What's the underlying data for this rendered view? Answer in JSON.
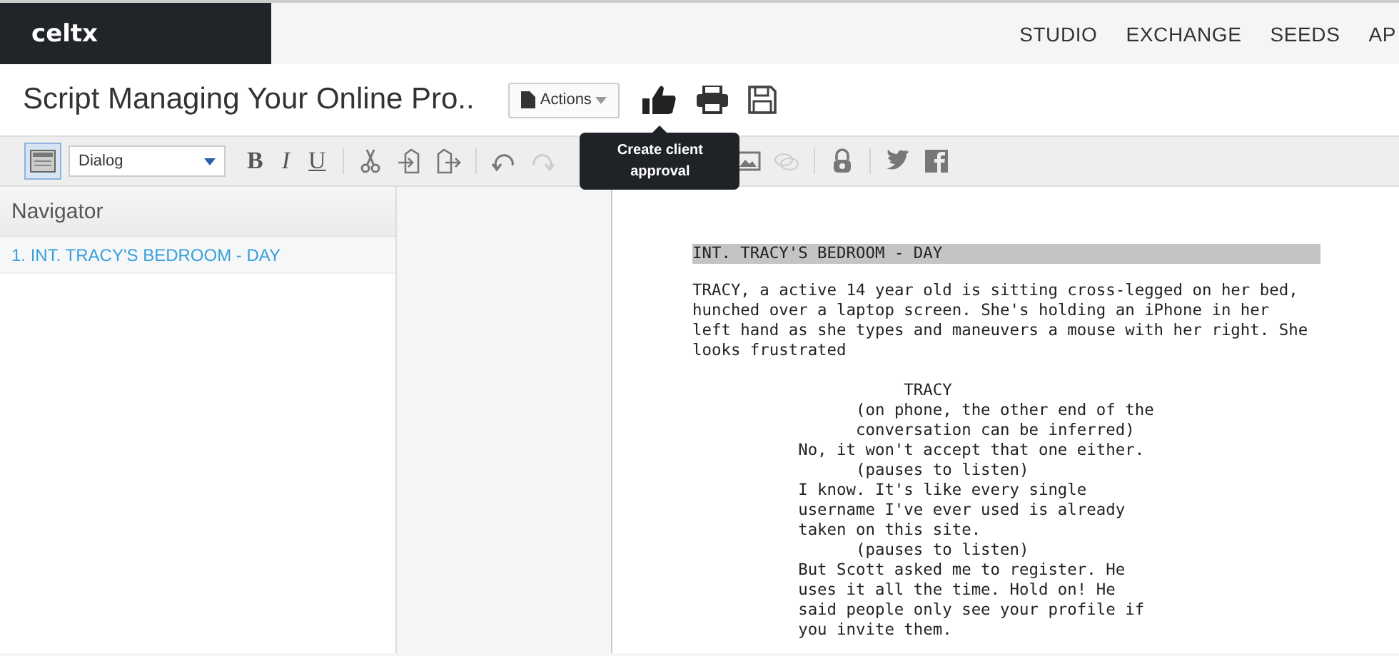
{
  "topbar": {
    "logo": "celtx",
    "nav": [
      {
        "label": "STUDIO"
      },
      {
        "label": "EXCHANGE"
      },
      {
        "label": "SEEDS"
      },
      {
        "label": "AP"
      }
    ]
  },
  "title_bar": {
    "title": "Script Managing Your Online Pro..",
    "actions_label": "Actions",
    "tooltip": "Create client approval"
  },
  "toolbar": {
    "layout_toggle_on": true,
    "style_select": "Dialog",
    "format_buttons": [
      {
        "label": "B",
        "kind": "bold"
      },
      {
        "label": "I",
        "kind": "italic"
      },
      {
        "label": "U",
        "kind": "underline"
      }
    ],
    "tools": [
      {
        "kind": "cut",
        "disabled": false
      },
      {
        "kind": "insert",
        "disabled": false
      },
      {
        "kind": "export",
        "disabled": false
      },
      {
        "kind": "sep"
      },
      {
        "kind": "undo",
        "disabled": false
      },
      {
        "kind": "redo",
        "disabled": true
      },
      {
        "kind": "gap"
      },
      {
        "kind": "image",
        "disabled": false
      },
      {
        "kind": "comment",
        "disabled": true
      },
      {
        "kind": "sep"
      },
      {
        "kind": "lock",
        "disabled": false
      },
      {
        "kind": "sep"
      },
      {
        "kind": "twitter",
        "disabled": false
      },
      {
        "kind": "facebook",
        "disabled": false
      }
    ]
  },
  "navigator": {
    "title": "Navigator",
    "items": [
      {
        "label": "1. INT. TRACY'S BEDROOM - DAY",
        "selected": true
      }
    ]
  },
  "script": [
    {
      "kind": "heading",
      "lines": [
        "INT. TRACY'S BEDROOM - DAY"
      ]
    },
    {
      "kind": "action",
      "lines": [
        "TRACY, a active 14 year old is sitting cross-legged on her bed,",
        "hunched over a laptop screen. She's holding an iPhone in her",
        "left hand as she types and maneuvers a mouse with her right. She",
        "looks frustrated"
      ]
    },
    {
      "kind": "character",
      "lines": [
        "TRACY"
      ]
    },
    {
      "kind": "parenthetical",
      "lines": [
        "(on phone, the other end of the",
        "conversation can be inferred)"
      ]
    },
    {
      "kind": "dialogue",
      "lines": [
        "No, it won't accept that one either."
      ]
    },
    {
      "kind": "parenthetical",
      "lines": [
        "(pauses to listen)"
      ]
    },
    {
      "kind": "dialogue",
      "lines": [
        "I know. It's like every single",
        "username I've ever used is already",
        "taken on this site."
      ]
    },
    {
      "kind": "parenthetical",
      "lines": [
        "(pauses to listen)"
      ]
    },
    {
      "kind": "dialogue",
      "lines": [
        "But Scott asked me to register. He",
        "uses it all the time. Hold on! He",
        "said people only see your profile if",
        "you invite them."
      ]
    }
  ]
}
